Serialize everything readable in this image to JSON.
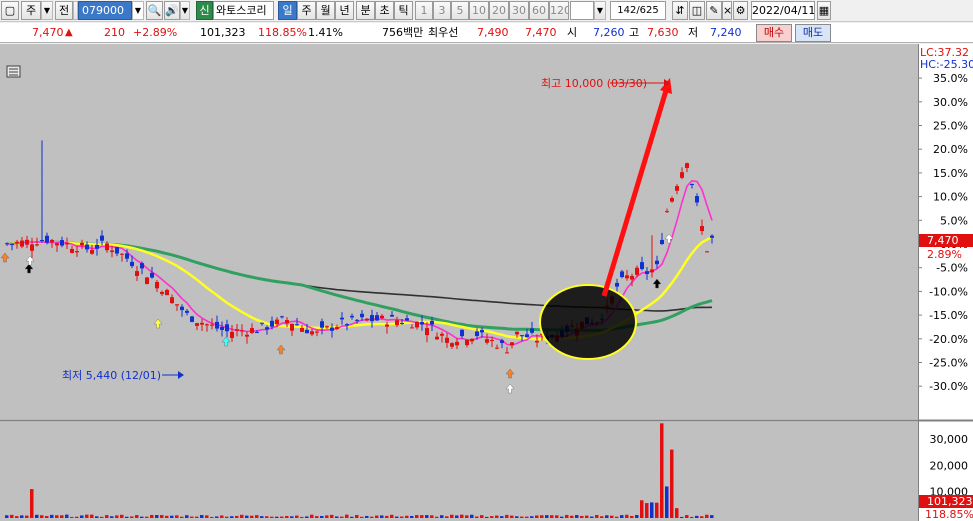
{
  "toolbar": {
    "type_label": "주",
    "scope_label": "전",
    "code_value": "079000",
    "badge_sin": "신",
    "stock_name": "와토스코리",
    "periods": [
      "일",
      "주",
      "월",
      "년",
      "분",
      "초",
      "틱"
    ],
    "intervals": [
      "1",
      "3",
      "5",
      "10",
      "20",
      "30",
      "60",
      "120"
    ],
    "count_value": "142",
    "count_total": "/625",
    "date_value": "2022/04/11"
  },
  "quote": {
    "price": "7,470",
    "arrow": "▲",
    "change": "210",
    "change_pct": "+2.89%",
    "volume": "101,323",
    "volume_ratio": "118.85%",
    "turnover_pct": "1.41%",
    "amount": "756백만",
    "best_ask_label": "최우선",
    "best_ask": "7,490",
    "best_bid": "7,470",
    "open_label": "시",
    "open": "7,260",
    "high_label": "고",
    "high": "7,630",
    "low_label": "저",
    "low": "7,240",
    "buy_label": "매수",
    "sell_label": "매도"
  },
  "chart_data": {
    "type": "candlestick",
    "top_right_labels": [
      "LC:37.32",
      "HC:-25.30"
    ],
    "price_axis_ticks": [
      "35.0%",
      "30.0%",
      "25.0%",
      "20.0%",
      "15.0%",
      "10.0%",
      "5.0%",
      "0.0%",
      "-5.0%",
      "-10.0%",
      "-15.0%",
      "-20.0%",
      "-25.0%",
      "-30.0%"
    ],
    "price_axis_values": [
      35,
      30,
      25,
      20,
      15,
      10,
      5,
      0,
      -5,
      -10,
      -15,
      -20,
      -25,
      -30
    ],
    "current_price_tag": "7,470",
    "current_pct_tag": "2.89%",
    "volume_axis_ticks": [
      "30,000",
      "20,000",
      "10,000"
    ],
    "volume_axis_values": [
      30000,
      20000,
      10000
    ],
    "current_volume_tag": "101,323",
    "current_volume_pct_tag": "118.85%",
    "annotation_high": "최고 10,000 (03/30)",
    "annotation_low": "최저 5,440 (12/01)",
    "colors": {
      "up": "#e01010",
      "down": "#1030d0",
      "ma5": "#ff30d0",
      "ma20": "#ffff20",
      "ma60": "#30a060",
      "ma120": "#303030",
      "background": "#c0c0c0"
    }
  }
}
